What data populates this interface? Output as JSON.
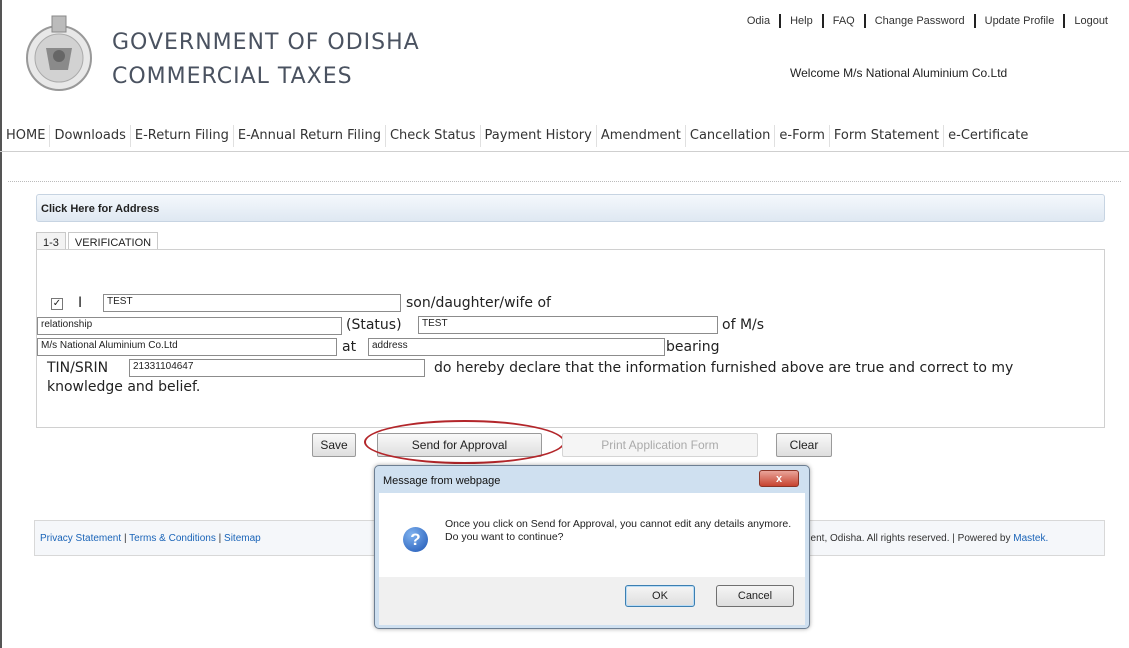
{
  "header": {
    "title": "GOVERNMENT OF ODISHA",
    "subtitle": "COMMERCIAL TAXES",
    "welcome": "Welcome M/s National Aluminium Co.Ltd",
    "links": [
      "Odia",
      "Help",
      "FAQ",
      "Change Password",
      "Update Profile",
      "Logout"
    ]
  },
  "nav": {
    "items": [
      "HOME",
      "Downloads",
      "E-Return Filing",
      "E-Annual Return Filing",
      "Check Status",
      "Payment History",
      "Amendment",
      "Cancellation",
      "e-Form",
      "Form Statement",
      "e-Certificate"
    ]
  },
  "address_bar": {
    "label": "Click Here for Address"
  },
  "tabs": [
    {
      "label": "1-3",
      "active": false
    },
    {
      "label": "VERIFICATION",
      "active": true
    }
  ],
  "form": {
    "checkbox_checked": "✓",
    "i_label": "I",
    "name_value": "TEST",
    "son_text": "son/daughter/wife of",
    "relationship_value": "relationship",
    "status_label": "(Status)",
    "status_value": "TEST",
    "of_ms_text": "of M/s",
    "company_value": "M/s National Aluminium Co.Ltd",
    "at_text": "at",
    "address_value": "address",
    "bearing_text": "bearing",
    "tin_label": "TIN/SRIN",
    "tin_value": "21331104647",
    "declare_text": "do hereby declare that the information furnished above are true and correct to my",
    "declare_text2": "knowledge and belief."
  },
  "buttons": {
    "save": "Save",
    "send": "Send for Approval",
    "print": "Print Application Form",
    "clear": "Clear"
  },
  "footer": {
    "privacy": "Privacy Statement",
    "terms": "Terms & Conditions",
    "sitemap": "Sitemap",
    "sep": "|",
    "right_text": "nent, Odisha. All rights reserved. | Powered by",
    "powered": "Mastek."
  },
  "dialog": {
    "title": "Message from webpage",
    "close": "x",
    "icon": "?",
    "message": "Once you click on Send for Approval, you cannot edit any details anymore. Do you want to continue?",
    "ok": "OK",
    "cancel": "Cancel"
  },
  "colors": {
    "highlight_oval": "#b3262a",
    "link": "#1a64b8"
  }
}
